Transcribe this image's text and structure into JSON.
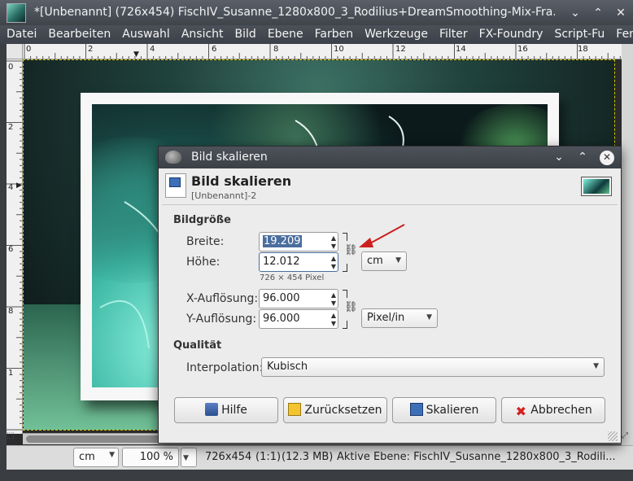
{
  "window": {
    "title": "*[Unbenannt] (726x454) FischIV_Susanne_1280x800_3_Rodilius+DreamSmoothing-Mix-Fra...",
    "controls": {
      "minimize": "⌄",
      "maximize": "⌃",
      "close": "✕"
    }
  },
  "menu": [
    "Datei",
    "Bearbeiten",
    "Auswahl",
    "Ansicht",
    "Bild",
    "Ebene",
    "Farben",
    "Werkzeuge",
    "Filter",
    "FX-Foundry",
    "Script-Fu",
    "Fenst"
  ],
  "ruler_top_labels": [
    "0",
    "2",
    "4",
    "6",
    "8",
    "10",
    "12",
    "14",
    "16",
    "18"
  ],
  "ruler_left_labels": [
    "0",
    "2",
    "4",
    "6",
    "8",
    "1"
  ],
  "status": {
    "unit": "cm",
    "zoom": "100 %",
    "size": "726x454",
    "ratio": "(1:1)",
    "memory": "(12.3 MB)",
    "layer": "Aktive Ebene: FischIV_Susanne_1280x800_3_Rodili..."
  },
  "dialog": {
    "title": "Bild skalieren",
    "header_title": "Bild skalieren",
    "header_subtitle": "[Unbenannt]-2",
    "section_size": "Bildgröße",
    "width_label": "Breite:",
    "width_value": "19.209",
    "height_label": "Höhe:",
    "height_value": "12.012",
    "pixel_info": "726 × 454 Pixel",
    "size_unit": "cm",
    "xres_label": "X-Auflösung:",
    "xres_value": "96.000",
    "yres_label": "Y-Auflösung:",
    "yres_value": "96.000",
    "res_unit": "Pixel/in",
    "section_quality": "Qualität",
    "interp_label": "Interpolation:",
    "interp_value": "Kubisch",
    "buttons": {
      "help": "Hilfe",
      "reset": "Zurücksetzen",
      "scale": "Skalieren",
      "cancel": "Abbrechen"
    }
  },
  "colors": {
    "annotation_arrow": "#cc1f1f",
    "selection_border": "#d6c000"
  }
}
